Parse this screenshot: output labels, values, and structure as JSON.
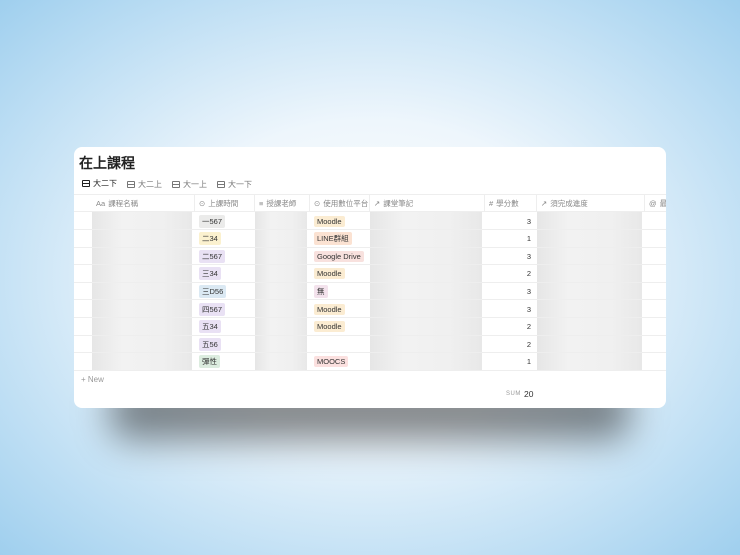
{
  "title": "在上課程",
  "tabs": [
    "大二下",
    "大二上",
    "大一上",
    "大一下"
  ],
  "columns": [
    {
      "icon": "Aa",
      "label": "課程名稱"
    },
    {
      "icon": "⊙",
      "label": "上課時間"
    },
    {
      "icon": "≡",
      "label": "授課老師"
    },
    {
      "icon": "⊙",
      "label": "使用數位平台"
    },
    {
      "icon": "↗",
      "label": "課堂筆記"
    },
    {
      "icon": "#",
      "label": "學分數"
    },
    {
      "icon": "↗",
      "label": "須完成進度"
    },
    {
      "icon": "@",
      "label": "最"
    }
  ],
  "rows": [
    {
      "time": "一567",
      "time_color": "#ebebea",
      "platform": "Moodle",
      "platform_color": "#fbecd2",
      "credits": "3"
    },
    {
      "time": "二34",
      "time_color": "#fbf1cf",
      "platform": "LINE群組",
      "platform_color": "#fbe2d2",
      "credits": "1"
    },
    {
      "time": "二567",
      "time_color": "#e9e1f4",
      "platform": "Google Drive",
      "platform_color": "#f8e1de",
      "credits": "3"
    },
    {
      "time": "三34",
      "time_color": "#e9e1f4",
      "platform": "Moodle",
      "platform_color": "#fbecd2",
      "credits": "2"
    },
    {
      "time": "三D56",
      "time_color": "#dbe9f3",
      "platform": "無",
      "platform_color": "#f3e2ec",
      "credits": "3"
    },
    {
      "time": "四567",
      "time_color": "#e9e1f4",
      "platform": "Moodle",
      "platform_color": "#fbecd2",
      "credits": "3"
    },
    {
      "time": "五34",
      "time_color": "#e9e1f4",
      "platform": "Moodle",
      "platform_color": "#fbecd2",
      "credits": "2"
    },
    {
      "time": "五56",
      "time_color": "#e9e1f4",
      "platform": "",
      "platform_color": "",
      "credits": "2"
    },
    {
      "time": "彈性",
      "time_color": "#dcecdf",
      "platform": "MOOCS",
      "platform_color": "#fbe0df",
      "credits": "1"
    }
  ],
  "new_label": "+ New",
  "sum_label": "SUM",
  "sum_value": "20"
}
